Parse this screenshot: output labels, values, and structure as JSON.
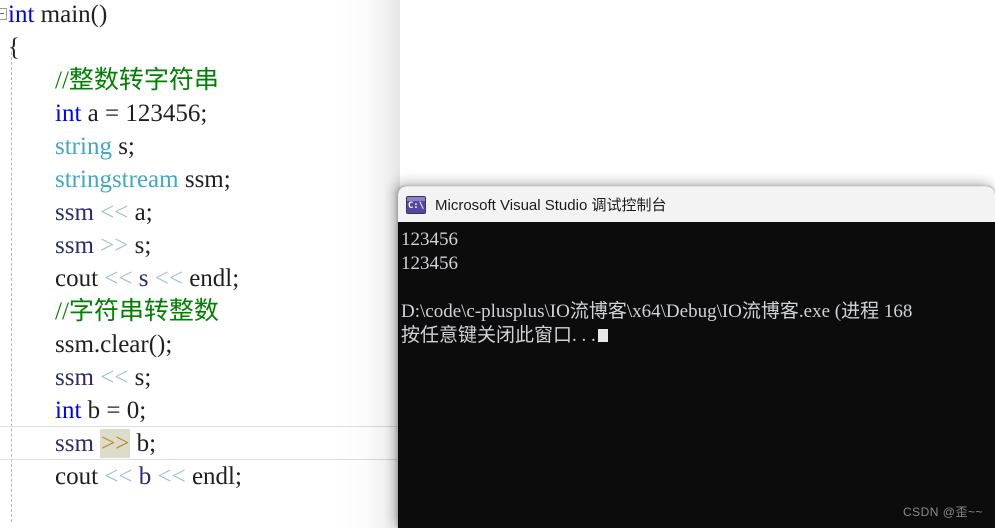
{
  "editor": {
    "name": "visual-studio-code-editor",
    "background": "#ffffff",
    "colors": {
      "keyword": "#0000ff",
      "type": "#3fa8c4",
      "comment": "#008000",
      "plain": "#1f1f1f",
      "operator": "#9fc4c8",
      "identifier": "#2b2b6e",
      "selected_operator_bg": "#dcdcc8",
      "selected_operator_fg": "#b58a2a",
      "current_line_border": "#dcdce8"
    },
    "lines": [
      {
        "indent": 0,
        "tokens": [
          {
            "text": "int",
            "style": "kw"
          },
          {
            "text": " main",
            "style": "plain"
          },
          {
            "text": "()",
            "style": "plain"
          }
        ]
      },
      {
        "indent": 0,
        "tokens": [
          {
            "text": "{",
            "style": "plain"
          }
        ]
      },
      {
        "indent": 1,
        "tokens": [
          {
            "text": "//整数转字符串",
            "style": "comment"
          }
        ]
      },
      {
        "indent": 1,
        "tokens": [
          {
            "text": "int",
            "style": "kw"
          },
          {
            "text": " a = ",
            "style": "plain"
          },
          {
            "text": "123456",
            "style": "num"
          },
          {
            "text": ";",
            "style": "plain"
          }
        ]
      },
      {
        "indent": 1,
        "tokens": [
          {
            "text": "string",
            "style": "type"
          },
          {
            "text": " s;",
            "style": "plain"
          }
        ]
      },
      {
        "indent": 1,
        "tokens": [
          {
            "text": "stringstream",
            "style": "type"
          },
          {
            "text": " ssm;",
            "style": "plain"
          }
        ]
      },
      {
        "indent": 1,
        "tokens": [
          {
            "text": "ssm ",
            "style": "ident"
          },
          {
            "text": "<<",
            "style": "op"
          },
          {
            "text": " a;",
            "style": "plain"
          }
        ]
      },
      {
        "indent": 1,
        "tokens": [
          {
            "text": "ssm ",
            "style": "ident"
          },
          {
            "text": ">>",
            "style": "op"
          },
          {
            "text": " s;",
            "style": "plain"
          }
        ]
      },
      {
        "indent": 1,
        "tokens": [
          {
            "text": "cout ",
            "style": "plain"
          },
          {
            "text": "<<",
            "style": "op"
          },
          {
            "text": " s ",
            "style": "ident"
          },
          {
            "text": "<<",
            "style": "op"
          },
          {
            "text": " endl;",
            "style": "plain"
          }
        ]
      },
      {
        "indent": 1,
        "tokens": [
          {
            "text": "//字符串转整数",
            "style": "comment"
          }
        ]
      },
      {
        "indent": 1,
        "tokens": [
          {
            "text": "ssm.clear();",
            "style": "plain"
          }
        ]
      },
      {
        "indent": 1,
        "tokens": [
          {
            "text": "ssm ",
            "style": "ident"
          },
          {
            "text": "<<",
            "style": "op"
          },
          {
            "text": " s;",
            "style": "plain"
          }
        ]
      },
      {
        "indent": 1,
        "tokens": [
          {
            "text": "int",
            "style": "kw"
          },
          {
            "text": " b = ",
            "style": "plain"
          },
          {
            "text": "0",
            "style": "num"
          },
          {
            "text": ";",
            "style": "plain"
          }
        ]
      },
      {
        "indent": 1,
        "current": true,
        "tokens": [
          {
            "text": "ssm ",
            "style": "ident"
          },
          {
            "text": ">>",
            "style": "op-sel"
          },
          {
            "text": " b;",
            "style": "plain"
          }
        ]
      },
      {
        "indent": 1,
        "tokens": [
          {
            "text": "cout ",
            "style": "plain"
          },
          {
            "text": "<<",
            "style": "op"
          },
          {
            "text": " b ",
            "style": "ident"
          },
          {
            "text": "<<",
            "style": "op"
          },
          {
            "text": " endl;",
            "style": "plain"
          }
        ]
      }
    ]
  },
  "console": {
    "title": "Microsoft Visual Studio 调试控制台",
    "icon_label": "C:\\",
    "icon_name": "console-app-icon",
    "background": "#0c0c0c",
    "titlebar_background": "#f3f3f3",
    "output_lines": [
      "123456",
      "123456",
      "",
      "D:\\code\\c-plusplus\\IO流博客\\x64\\Debug\\IO流博客.exe (进程 168",
      "按任意键关闭此窗口. . ."
    ]
  },
  "watermark": {
    "text": "CSDN @歪~~"
  }
}
